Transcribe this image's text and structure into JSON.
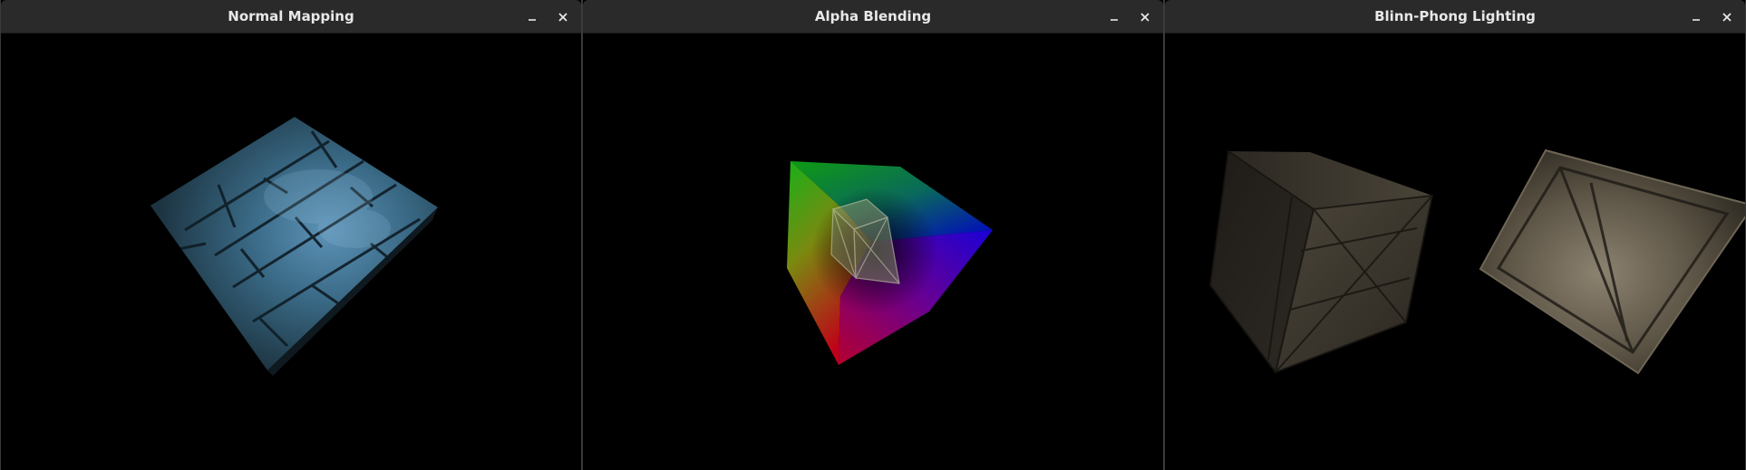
{
  "windows": [
    {
      "title": "Normal Mapping"
    },
    {
      "title": "Alpha Blending"
    },
    {
      "title": "Blinn-Phong Lighting"
    }
  ],
  "icons": {
    "minimize": "minimize-icon",
    "close": "close-icon"
  },
  "colors": {
    "titlebar": "#2a2a2a",
    "title_text": "#e8e8e8",
    "background": "#000000"
  }
}
